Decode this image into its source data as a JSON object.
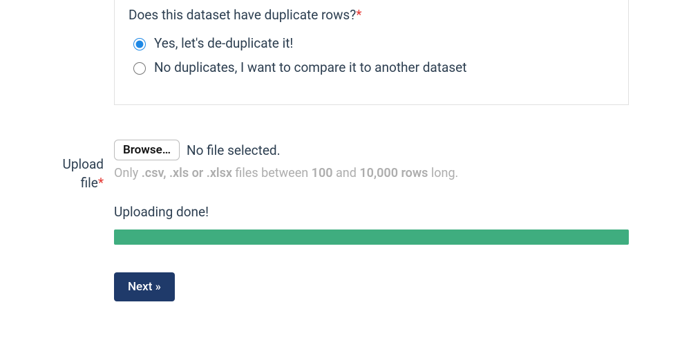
{
  "question": {
    "label": "Does this dataset have duplicate rows?",
    "required_mark": "*",
    "options": [
      {
        "label": "Yes, let's de-duplicate it!",
        "selected": true
      },
      {
        "label": "No duplicates, I want to compare it to another dataset",
        "selected": false
      }
    ]
  },
  "upload": {
    "field_label_1": "Upload",
    "field_label_2": "file",
    "required_mark": "*",
    "browse_label": "Browse…",
    "file_status": "No file selected.",
    "help_prefix": "Only ",
    "help_filetypes": ".csv, .xls or .xlsx",
    "help_mid1": " files between ",
    "help_num1": "100",
    "help_mid2": " and ",
    "help_num2": "10,000 rows",
    "help_suffix": " long."
  },
  "progress": {
    "status": "Uploading done!",
    "percent": 100
  },
  "nav": {
    "next_label": "Next »"
  }
}
